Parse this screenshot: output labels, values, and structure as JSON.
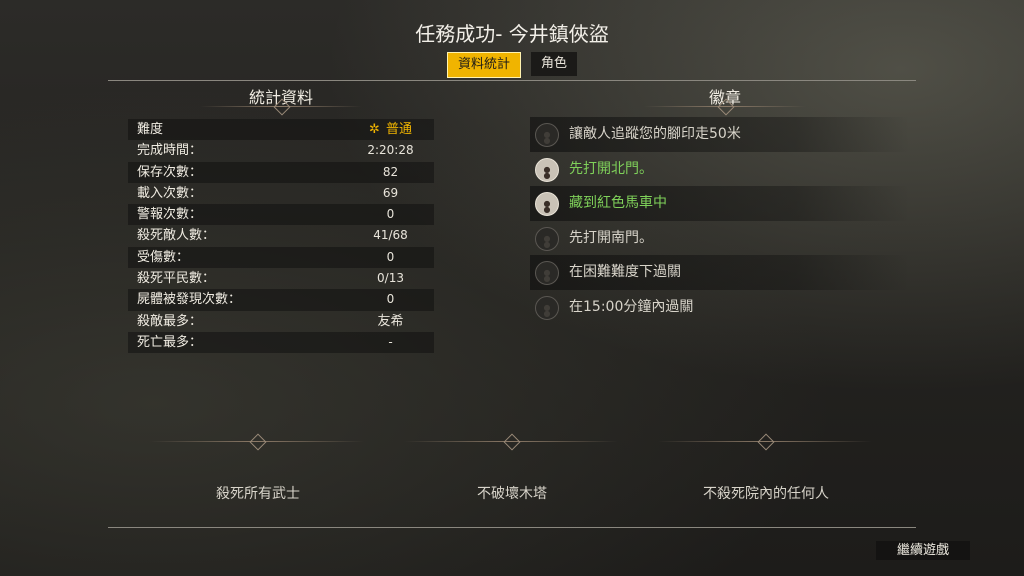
{
  "header": {
    "title": "任務成功- 今井鎮俠盜"
  },
  "tabs": [
    {
      "label": "資料統計",
      "active": true
    },
    {
      "label": "角色",
      "active": false
    }
  ],
  "stats": {
    "title": "統計資料",
    "rows": [
      {
        "label": "難度",
        "value": "普通",
        "icon": "sun-icon"
      },
      {
        "label": "完成時間：",
        "value": "2:20:28"
      },
      {
        "label": "保存次數：",
        "value": "82"
      },
      {
        "label": "載入次數：",
        "value": "69"
      },
      {
        "label": "警報次數：",
        "value": "0"
      },
      {
        "label": "殺死敵人數：",
        "value": "41/68"
      },
      {
        "label": "受傷數：",
        "value": "0"
      },
      {
        "label": "殺死平民數：",
        "value": "0/13"
      },
      {
        "label": "屍體被發現次數：",
        "value": "0"
      },
      {
        "label": "殺敵最多：",
        "value": "友希"
      },
      {
        "label": "死亡最多：",
        "value": "-"
      }
    ]
  },
  "badges": {
    "title": "徽章",
    "items": [
      {
        "text": "讓敵人追蹤您的腳印走50米",
        "earned": false
      },
      {
        "text": "先打開北門。",
        "earned": true
      },
      {
        "text": "藏到紅色馬車中",
        "earned": true
      },
      {
        "text": "先打開南門。",
        "earned": false
      },
      {
        "text": "在困難難度下過關",
        "earned": false
      },
      {
        "text": "在15:00分鐘內過關",
        "earned": false
      }
    ]
  },
  "challenges": [
    "殺死所有武士",
    "不破壞木塔",
    "不殺死院內的任何人"
  ],
  "footer": {
    "continue_label": "繼續遊戲"
  },
  "colors": {
    "accent": "#f0b400",
    "earned": "#7fd15a",
    "text": "#e8e4da"
  }
}
